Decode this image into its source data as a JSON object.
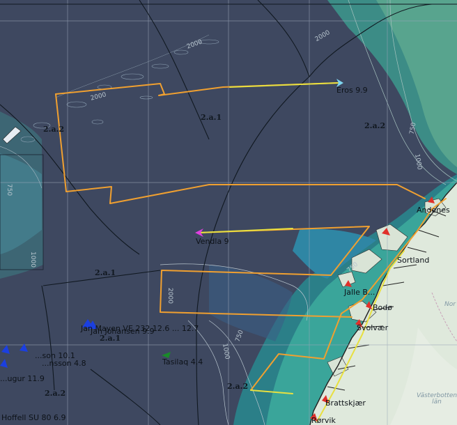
{
  "map": {
    "zones": [
      {
        "id": "2a1-north",
        "label": "2.a.1"
      },
      {
        "id": "2a2-west",
        "label": "2.a.2"
      },
      {
        "id": "2a2-east",
        "label": "2.a.2"
      },
      {
        "id": "2a1-south",
        "label": "2.a.1"
      },
      {
        "id": "2a1-sw",
        "label": "2.a.1"
      },
      {
        "id": "2a2-sw",
        "label": "2.a.2"
      },
      {
        "id": "2a2-coast",
        "label": "2.a.2"
      }
    ],
    "vessels": [
      {
        "id": "eros",
        "label": "Eros 9.9",
        "color": "#7fd6f0"
      },
      {
        "id": "vendla",
        "label": "Vendla 9",
        "color": "#e040e0"
      },
      {
        "id": "tasilaq",
        "label": "Tasilaq 4.4",
        "color": "#1a8a2a"
      },
      {
        "id": "cluster-mid",
        "label": "Jan Mayen VE 232 12.6 ... 12.7",
        "color": "#1b3fe0"
      },
      {
        "id": "cluster-mid2",
        "label": "Jan Johansen 9.9",
        "color": "#1b3fe0"
      },
      {
        "id": "cluster-west1",
        "label": "...son 10.1",
        "color": "#1b3fe0"
      },
      {
        "id": "cluster-west2",
        "label": "...nsson 4.8",
        "color": "#1b3fe0"
      },
      {
        "id": "cluster-west3",
        "label": "...ugur 11.9",
        "color": "#1b3fe0"
      },
      {
        "id": "hoffell",
        "label": "Hoffell SU 80 6.9",
        "color": "#1b3fe0"
      }
    ],
    "places": [
      {
        "id": "sortland",
        "label": "Sortland"
      },
      {
        "id": "andenes",
        "label": "Andenes"
      },
      {
        "id": "jaeren",
        "label": "Jalle B..."
      },
      {
        "id": "bodo",
        "label": "Bodø"
      },
      {
        "id": "svolvaer",
        "label": "Svolvær"
      },
      {
        "id": "brattskjaer",
        "label": "Brattskjær"
      },
      {
        "id": "rorvik",
        "label": "Rørvik"
      }
    ],
    "regions": [
      {
        "id": "norr",
        "label": "Nor"
      },
      {
        "id": "vasterbotten",
        "label": "Västerbotten län"
      }
    ],
    "contours": [
      "2000",
      "2000",
      "750",
      "1000",
      "750",
      "1000",
      "2000",
      "750",
      "1000",
      "2000",
      "750"
    ],
    "colors": {
      "deep_sea": "#3e4860",
      "shelf": "#2a8a8a",
      "land": "#dfe9dc",
      "track": "#f0a030",
      "track_alt": "#e8e040",
      "grid": "#9aa6b8",
      "zone_border": "#101820"
    }
  }
}
